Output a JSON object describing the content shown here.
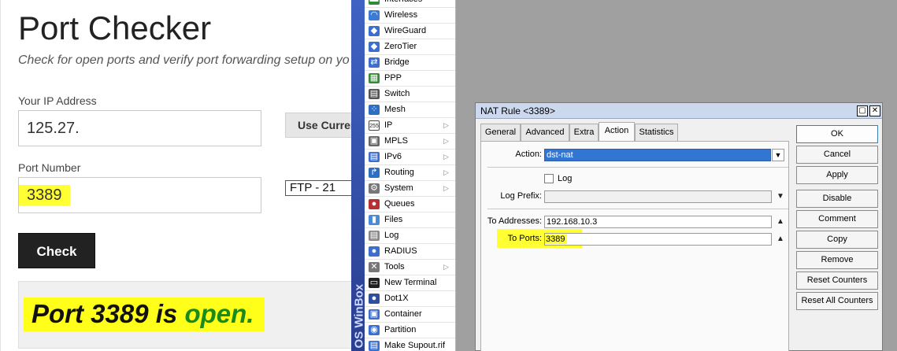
{
  "web": {
    "title": "Port Checker",
    "subtitle": "Check for open ports and verify port forwarding setup on yo",
    "ip_label": "Your IP Address",
    "ip_value": "125.27.",
    "use_current_label": "Use Curren",
    "port_label": "Port Number",
    "port_value": "3389",
    "service_select": "FTP - 21",
    "check_label": "Check",
    "result_prefix": "Port 3389 is ",
    "result_status": "open.",
    "highlight_color": "#ffff33",
    "open_color": "#1a8a1a"
  },
  "winbox": {
    "side_label": "OS WinBox",
    "menu": [
      {
        "label": "Interfaces",
        "icon": "interfaces-icon",
        "arrow": false
      },
      {
        "label": "Wireless",
        "icon": "wireless-icon",
        "arrow": false
      },
      {
        "label": "WireGuard",
        "icon": "wireguard-icon",
        "arrow": false
      },
      {
        "label": "ZeroTier",
        "icon": "zerotier-icon",
        "arrow": false
      },
      {
        "label": "Bridge",
        "icon": "bridge-icon",
        "arrow": false
      },
      {
        "label": "PPP",
        "icon": "ppp-icon",
        "arrow": false
      },
      {
        "label": "Switch",
        "icon": "switch-icon",
        "arrow": false
      },
      {
        "label": "Mesh",
        "icon": "mesh-icon",
        "arrow": false
      },
      {
        "label": "IP",
        "icon": "ip-icon",
        "arrow": true
      },
      {
        "label": "MPLS",
        "icon": "mpls-icon",
        "arrow": true
      },
      {
        "label": "IPv6",
        "icon": "ipv6-icon",
        "arrow": true
      },
      {
        "label": "Routing",
        "icon": "routing-icon",
        "arrow": true
      },
      {
        "label": "System",
        "icon": "system-gear-icon",
        "arrow": true
      },
      {
        "label": "Queues",
        "icon": "queues-icon",
        "arrow": false
      },
      {
        "label": "Files",
        "icon": "files-icon",
        "arrow": false
      },
      {
        "label": "Log",
        "icon": "log-icon",
        "arrow": false
      },
      {
        "label": "RADIUS",
        "icon": "radius-icon",
        "arrow": false
      },
      {
        "label": "Tools",
        "icon": "tools-icon",
        "arrow": true
      },
      {
        "label": "New Terminal",
        "icon": "terminal-icon",
        "arrow": false
      },
      {
        "label": "Dot1X",
        "icon": "dot1x-icon",
        "arrow": false
      },
      {
        "label": "Container",
        "icon": "container-icon",
        "arrow": false
      },
      {
        "label": "Partition",
        "icon": "partition-icon",
        "arrow": false
      },
      {
        "label": "Make Supout.rif",
        "icon": "supout-icon",
        "arrow": false
      }
    ]
  },
  "nat": {
    "window_title": "NAT Rule <3389>",
    "tabs": [
      "General",
      "Advanced",
      "Extra",
      "Action",
      "Statistics"
    ],
    "active_tab": "Action",
    "action_label": "Action:",
    "action_value": "dst-nat",
    "log_label": "Log",
    "log_prefix_label": "Log Prefix:",
    "log_prefix_value": "",
    "to_addresses_label": "To Addresses:",
    "to_addresses_value": "192.168.10.3",
    "to_ports_label": "To Ports:",
    "to_ports_value": "3389",
    "buttons": [
      "OK",
      "Cancel",
      "Apply",
      "Disable",
      "Comment",
      "Copy",
      "Remove",
      "Reset Counters",
      "Reset All Counters"
    ]
  }
}
